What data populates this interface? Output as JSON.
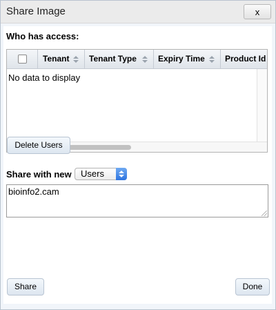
{
  "dialog": {
    "title": "Share Image",
    "close_label": "x"
  },
  "access": {
    "heading": "Who has access:",
    "columns": [
      "Tenant",
      "Tenant Type",
      "Expiry Time",
      "Product Id"
    ],
    "empty_message": "No data to display"
  },
  "buttons": {
    "delete_users": "Delete Users",
    "share": "Share",
    "done": "Done"
  },
  "share_new": {
    "label": "Share with new",
    "selected_option": "Users",
    "input_value": "bioinfo2.cam"
  }
}
